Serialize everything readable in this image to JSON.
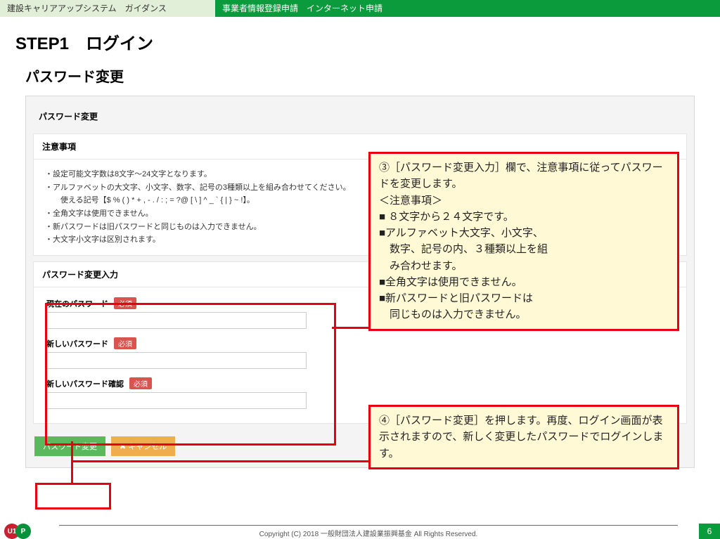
{
  "header": {
    "left": "建設キャリアアップシステム　ガイダンス",
    "right": "事業者情報登録申請　インターネット申請"
  },
  "step_title": "STEP1　ログイン",
  "page_title": "パスワード変更",
  "panel": {
    "title": "パスワード変更",
    "notice": {
      "title": "注意事項",
      "lines": [
        "・設定可能文字数は8文字～24文字となります。",
        "・アルファベットの大文字、小文字、数字、記号の3種類以上を組み合わせてください。",
        "　使える記号【$ % ( ) * + , - . / : ; = ?@ [ \\ ] ^ _ ` { | } ~ !】。",
        "・全角文字は使用できません。",
        "・新パスワードは旧パスワードと同じものは入力できません。",
        "・大文字小文字は区別されます。"
      ]
    },
    "form": {
      "title": "パスワード変更入力",
      "req": "必須",
      "fields": {
        "current": "現在のパスワード",
        "new": "新しいパスワード",
        "confirm": "新しいパスワード確認"
      }
    },
    "buttons": {
      "submit": "パスワード変更",
      "cancel": "✖ キャンセル"
    }
  },
  "callouts": {
    "c3": "③［パスワード変更入力］欄で、注意事項に従ってパスワードを変更します。\n＜注意事項＞\n■ ８文字から２４文字です。\n■アルファベット大文字、小文字、\n　数字、記号の内、３種類以上を組\n　み合わせます。\n■全角文字は使用できません。\n■新パスワードと旧パスワードは\n　同じものは入力できません。",
    "c4": "④［パスワード変更］を押します。再度、ログイン画面が表示されますので、新しく変更したパスワードでログインします。"
  },
  "footer": {
    "copy": "Copyright (C) 2018 一般財団法人建設業振興基金 All Rights Reserved.",
    "page": "6"
  }
}
